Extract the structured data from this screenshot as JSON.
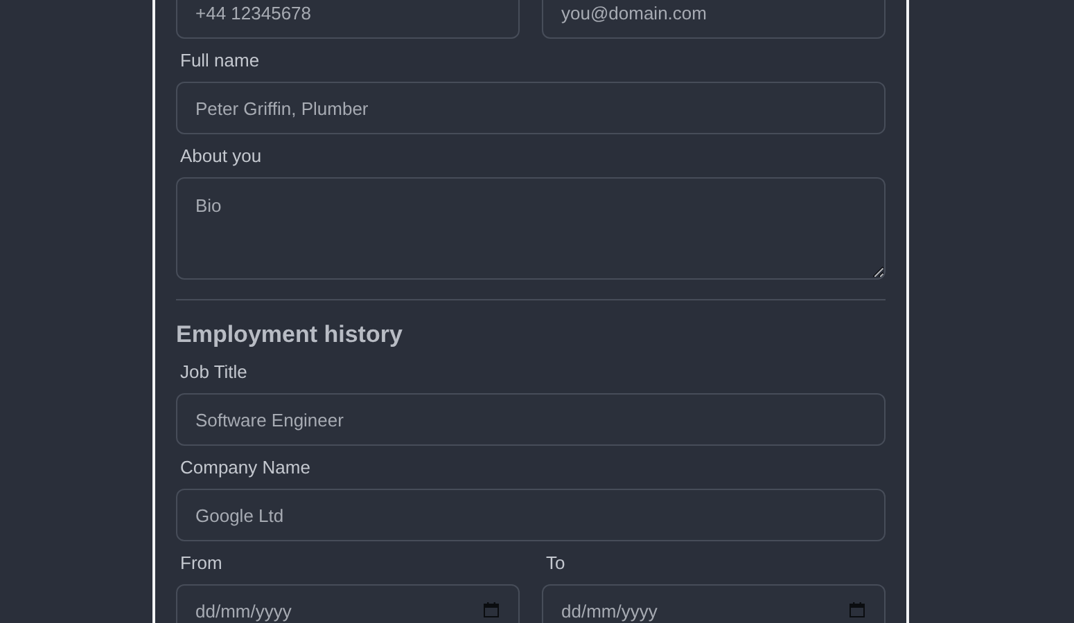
{
  "contact_row": [
    {
      "kind": "text",
      "placeholder": "+44 12345678"
    },
    {
      "kind": "text",
      "placeholder": "you@domain.com"
    }
  ],
  "profile": [
    {
      "kind": "text",
      "label": "Full name",
      "placeholder": "Peter Griffin, Plumber"
    },
    {
      "kind": "textarea",
      "label": "About you",
      "placeholder": "Bio"
    }
  ],
  "employment": {
    "heading": "Employment history",
    "fields": [
      {
        "kind": "text",
        "label": "Job Title",
        "placeholder": "Software Engineer"
      },
      {
        "kind": "text",
        "label": "Company Name",
        "placeholder": "Google Ltd"
      }
    ],
    "dates": [
      {
        "kind": "date",
        "label": "From",
        "placeholder": "dd/mm/yyyy"
      },
      {
        "kind": "date",
        "label": "To",
        "placeholder": "dd/mm/yyyy"
      }
    ]
  }
}
